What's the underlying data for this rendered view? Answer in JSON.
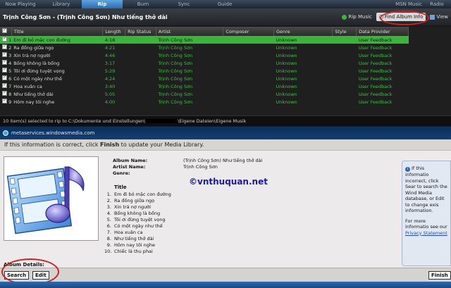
{
  "nav": {
    "tabs": [
      "Now Playing",
      "Library",
      "Rip",
      "Burn",
      "Sync",
      "Guide"
    ],
    "active": "Rip",
    "right_tabs": [
      "MSN Music",
      "Radio"
    ]
  },
  "titlebar": {
    "title": "Trịnh Công Sơn - (Trịnh Công Sơn) Như tiếng thở dài",
    "rip_music": "Rip Music",
    "find_album_info": "Find Album Info",
    "view": "View"
  },
  "table": {
    "columns": [
      "Title",
      "Length",
      "Rip Status",
      "Artist",
      "Composer",
      "Genre",
      "Style",
      "Data Provider"
    ],
    "rows": [
      {
        "n": "1",
        "title": "Em đi bỏ mặc con đường",
        "length": "4:18",
        "artist": "Trịnh Công Sơn",
        "genre": "Unknown",
        "provider": "User Feedback"
      },
      {
        "n": "2",
        "title": "Ra đồng giữa ngọ",
        "length": "4:21",
        "artist": "Trịnh Công Sơn",
        "genre": "Unknown",
        "provider": "User Feedback"
      },
      {
        "n": "3",
        "title": "Xin trả nợ người",
        "length": "4:46",
        "artist": "Trịnh Công Sơn",
        "genre": "Unknown",
        "provider": "User Feedback"
      },
      {
        "n": "4",
        "title": "Bống không là bống",
        "length": "3:17",
        "artist": "Trịnh Công Sơn",
        "genre": "Unknown",
        "provider": "User Feedback"
      },
      {
        "n": "5",
        "title": "Tôi ơi đừng tuyệt vọng",
        "length": "5:29",
        "artist": "Trịnh Công Sơn",
        "genre": "Unknown",
        "provider": "User Feedback"
      },
      {
        "n": "6",
        "title": "Có một ngày như thế",
        "length": "4:24",
        "artist": "Trịnh Công Sơn",
        "genre": "Unknown",
        "provider": "User Feedback"
      },
      {
        "n": "7",
        "title": "Hoa xuân ca",
        "length": "3:40",
        "artist": "Trịnh Công Sơn",
        "genre": "Unknown",
        "provider": "User Feedback"
      },
      {
        "n": "8",
        "title": "Như tiếng thở dài",
        "length": "5:05",
        "artist": "Trịnh Công Sơn",
        "genre": "Unknown",
        "provider": "User Feedback"
      },
      {
        "n": "9",
        "title": "Hôm nay tôi nghe",
        "length": "4:00",
        "artist": "Trịnh Công Sơn",
        "genre": "Unknown",
        "provider": "User Feedback"
      }
    ]
  },
  "status": {
    "prefix": "10 item(s) selected to rip to C:\\Dokumente und Einstellungen\\",
    "suffix": "\\Eigene Dateien\\Eigene Musik"
  },
  "url": "metaservices.windowsmedia.com",
  "info": {
    "pre": "If this information is correct, click ",
    "bold": "Finish",
    "post": " to update your Media Library."
  },
  "album": {
    "name_label": "Album Name:",
    "name": "(Trịnh Công Sơn) Như tiếng thở dài",
    "artist_label": "Artist Name:",
    "artist": "Trịnh Công Sơn",
    "genre_label": "Genre:",
    "genre": ""
  },
  "tracks": {
    "header": "Title",
    "items": [
      "Em đi bỏ mặc con đường",
      "Ra đồng giữa ngọ",
      "Xin trả nợ người",
      "Bống không là bống",
      "Tôi ơi đừng tuyệt vọng",
      "Có một ngày như thế",
      "Hoa xuân ca",
      "Như tiếng thở dài",
      "Hôm nay tôi nghe",
      "Chiếc lá thu phai"
    ]
  },
  "watermark": "©vnthuquan.net",
  "sidebox": {
    "line1": "If this informatio incorrect, click Sear to search the Wind Media database, or Edit to change exis information.",
    "line2": "For more informatio see our",
    "link": "Privacy Statement"
  },
  "details": {
    "label": "Album Details:",
    "search": "Search",
    "edit": "Edit"
  },
  "finish": "Finish"
}
